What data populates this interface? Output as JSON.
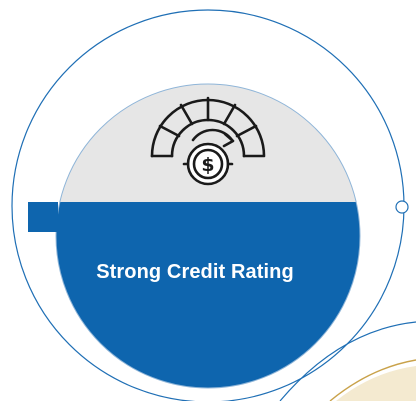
{
  "card": {
    "title": "Strong Credit Rating",
    "icon": "credit-score-gauge-icon"
  },
  "colors": {
    "blue": "#0E65AE",
    "gray": "#E6E6E6",
    "outline": "#1F6FB5",
    "gold": "#C9A24A"
  }
}
